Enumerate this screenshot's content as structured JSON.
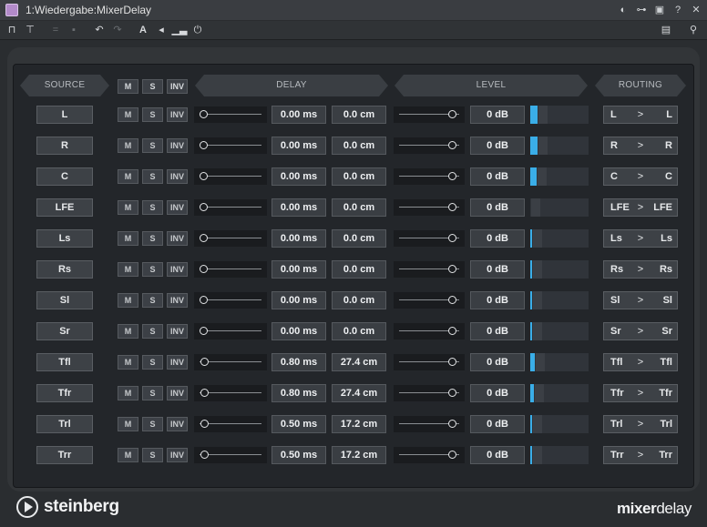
{
  "window": {
    "title": "1:Wiedergabe:MixerDelay",
    "swatch_color": "#b28ac9",
    "title_icons": [
      "contrast-icon",
      "link-icon",
      "window-icon",
      "help-icon",
      "close-icon"
    ]
  },
  "toolbar": {
    "left_icons": [
      "bypass-icon",
      "activate-icon",
      "prev-preset-icon",
      "next-preset-icon",
      "undo-icon",
      "redo-icon",
      "text-icon",
      "back-icon",
      "meter-icon",
      "power-icon"
    ],
    "right_icons": [
      "preset-icon",
      "search-icon"
    ]
  },
  "headers": {
    "source": "SOURCE",
    "m": "M",
    "s": "S",
    "inv": "INV",
    "delay": "DELAY",
    "level": "LEVEL",
    "routing": "ROUTING"
  },
  "row_buttons": {
    "m": "M",
    "s": "S",
    "inv": "INV",
    "route_sep": ">"
  },
  "accent_color": "#3aaee8",
  "channels": [
    {
      "name": "L",
      "delay_ms": "0.00 ms",
      "delay_cm": "0.0 cm",
      "delay_pos": 0.0,
      "level": "0 dB",
      "level_pos": 0.85,
      "meter": 0.12,
      "route_src": "L",
      "route_dst": "L"
    },
    {
      "name": "R",
      "delay_ms": "0.00 ms",
      "delay_cm": "0.0 cm",
      "delay_pos": 0.0,
      "level": "0 dB",
      "level_pos": 0.85,
      "meter": 0.12,
      "route_src": "R",
      "route_dst": "R"
    },
    {
      "name": "C",
      "delay_ms": "0.00 ms",
      "delay_cm": "0.0 cm",
      "delay_pos": 0.0,
      "level": "0 dB",
      "level_pos": 0.85,
      "meter": 0.11,
      "route_src": "C",
      "route_dst": "C"
    },
    {
      "name": "LFE",
      "delay_ms": "0.00 ms",
      "delay_cm": "0.0 cm",
      "delay_pos": 0.0,
      "level": "0 dB",
      "level_pos": 0.85,
      "meter": 0.0,
      "route_src": "LFE",
      "route_dst": "LFE"
    },
    {
      "name": "Ls",
      "delay_ms": "0.00 ms",
      "delay_cm": "0.0 cm",
      "delay_pos": 0.0,
      "level": "0 dB",
      "level_pos": 0.85,
      "meter": 0.02,
      "route_src": "Ls",
      "route_dst": "Ls"
    },
    {
      "name": "Rs",
      "delay_ms": "0.00 ms",
      "delay_cm": "0.0 cm",
      "delay_pos": 0.0,
      "level": "0 dB",
      "level_pos": 0.85,
      "meter": 0.02,
      "route_src": "Rs",
      "route_dst": "Rs"
    },
    {
      "name": "Sl",
      "delay_ms": "0.00 ms",
      "delay_cm": "0.0 cm",
      "delay_pos": 0.0,
      "level": "0 dB",
      "level_pos": 0.85,
      "meter": 0.02,
      "route_src": "Sl",
      "route_dst": "Sl"
    },
    {
      "name": "Sr",
      "delay_ms": "0.00 ms",
      "delay_cm": "0.0 cm",
      "delay_pos": 0.0,
      "level": "0 dB",
      "level_pos": 0.85,
      "meter": 0.02,
      "route_src": "Sr",
      "route_dst": "Sr"
    },
    {
      "name": "Tfl",
      "delay_ms": "0.80 ms",
      "delay_cm": "27.4 cm",
      "delay_pos": 0.02,
      "level": "0 dB",
      "level_pos": 0.85,
      "meter": 0.08,
      "route_src": "Tfl",
      "route_dst": "Tfl"
    },
    {
      "name": "Tfr",
      "delay_ms": "0.80 ms",
      "delay_cm": "27.4 cm",
      "delay_pos": 0.02,
      "level": "0 dB",
      "level_pos": 0.85,
      "meter": 0.06,
      "route_src": "Tfr",
      "route_dst": "Tfr"
    },
    {
      "name": "Trl",
      "delay_ms": "0.50 ms",
      "delay_cm": "17.2 cm",
      "delay_pos": 0.01,
      "level": "0 dB",
      "level_pos": 0.85,
      "meter": 0.02,
      "route_src": "Trl",
      "route_dst": "Trl"
    },
    {
      "name": "Trr",
      "delay_ms": "0.50 ms",
      "delay_cm": "17.2 cm",
      "delay_pos": 0.01,
      "level": "0 dB",
      "level_pos": 0.85,
      "meter": 0.02,
      "route_src": "Trr",
      "route_dst": "Trr"
    }
  ],
  "footer": {
    "brand": "steinberg",
    "product_prefix": "mixer",
    "product_suffix": "delay"
  }
}
